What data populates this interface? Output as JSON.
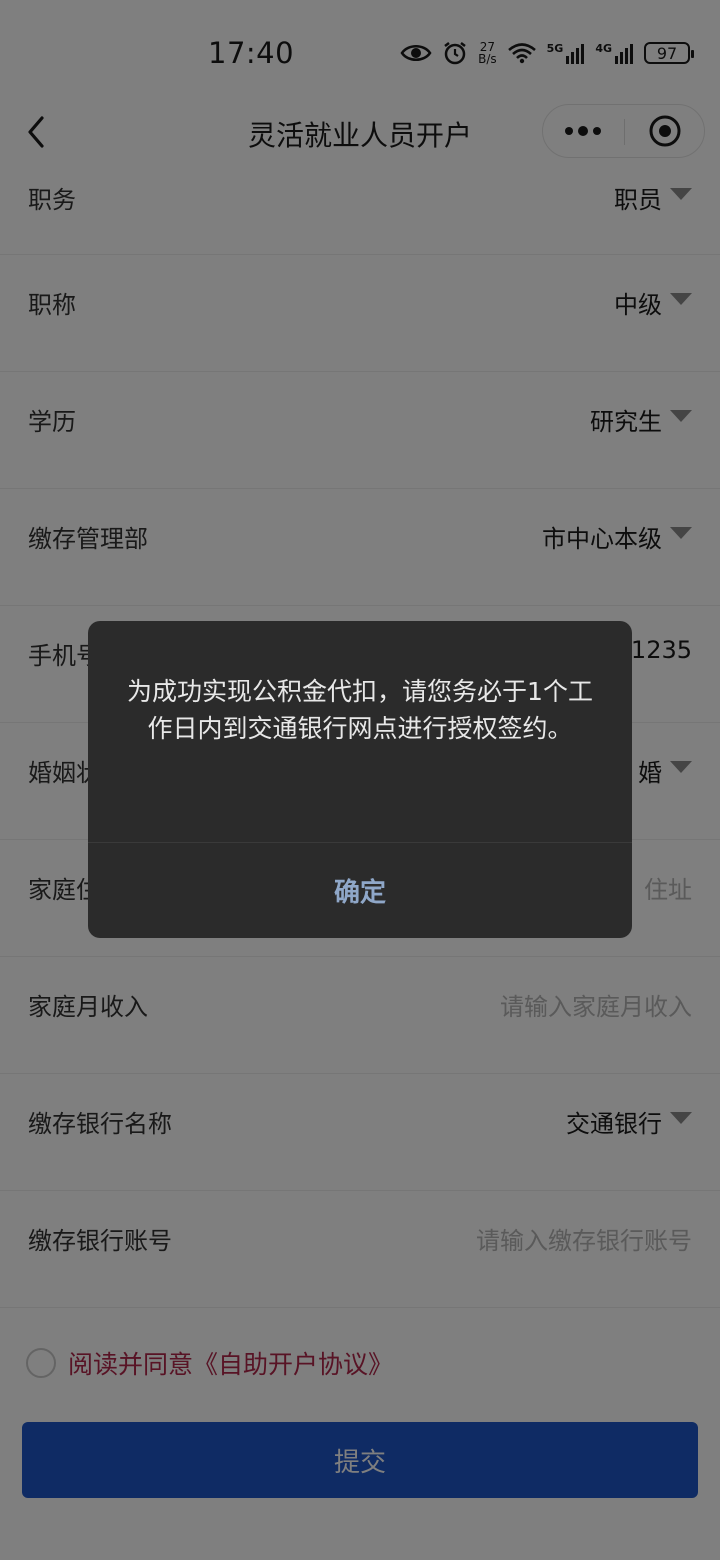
{
  "status_bar": {
    "time": "17:40",
    "net_speed_value": "27",
    "net_speed_unit": "B/s",
    "signal_1": "5G",
    "signal_2": "4G",
    "battery": "97"
  },
  "nav": {
    "title": "灵活就业人员开户"
  },
  "form": {
    "rows": [
      {
        "label": "职务",
        "value": "职员"
      },
      {
        "label": "职称",
        "value": "中级"
      },
      {
        "label": "学历",
        "value": "研究生"
      },
      {
        "label": "缴存管理部",
        "value": "市中心本级"
      },
      {
        "label": "手机号",
        "value": "1235"
      },
      {
        "label": "婚姻状况",
        "value": "婚"
      },
      {
        "label": "家庭住址",
        "placeholder": "住址"
      },
      {
        "label": "家庭月收入",
        "placeholder": "请输入家庭月收入"
      },
      {
        "label": "缴存银行名称",
        "value": "交通银行"
      },
      {
        "label": "缴存银行账号",
        "placeholder": "请输入缴存银行账号"
      }
    ]
  },
  "agreement": {
    "text": "阅读并同意《自助开户协议》"
  },
  "submit_label": "提交",
  "dialog": {
    "message": "为成功实现公积金代扣，请您务必于1个工作日内到交通银行网点进行授权签约。",
    "confirm_label": "确定"
  },
  "colors": {
    "primary": "#1e57c8",
    "agreement_text": "#b0274b",
    "dialog_bg": "#2b2b2b",
    "dialog_button": "#8fa7c8"
  }
}
